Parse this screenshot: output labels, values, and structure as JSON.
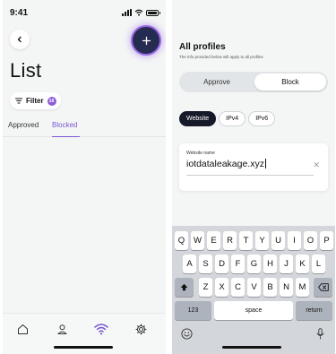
{
  "left": {
    "status": {
      "time": "9:41"
    },
    "title": "List",
    "filter": {
      "label": "Filter",
      "count": "16"
    },
    "tabs": [
      {
        "label": "Approved",
        "active": false
      },
      {
        "label": "Blocked",
        "active": true
      }
    ],
    "nav": [
      "home-icon",
      "user-icon",
      "wifi-icon",
      "settings-icon"
    ],
    "colors": {
      "accent": "#7a56d4",
      "add_button": "#262b52",
      "glow": "#9b6ae6"
    }
  },
  "right": {
    "heading": "All profiles",
    "subheading": "The info provided below will apply to all profiles",
    "segment": {
      "approve": "Approve",
      "block": "Block",
      "selected": "Block"
    },
    "chips": [
      {
        "label": "Website",
        "active": true
      },
      {
        "label": "IPv4",
        "active": false
      },
      {
        "label": "IPv6",
        "active": false
      }
    ],
    "input": {
      "label": "Website name",
      "value": "iotdataleakage.xyz"
    },
    "keyboard": {
      "row1": [
        "Q",
        "W",
        "E",
        "R",
        "T",
        "Y",
        "U",
        "I",
        "O",
        "P"
      ],
      "row2": [
        "A",
        "S",
        "D",
        "F",
        "G",
        "H",
        "J",
        "K",
        "L"
      ],
      "row3": [
        "Z",
        "X",
        "C",
        "V",
        "B",
        "N",
        "M"
      ],
      "numbers": "123",
      "space": "space",
      "return": "return"
    }
  }
}
